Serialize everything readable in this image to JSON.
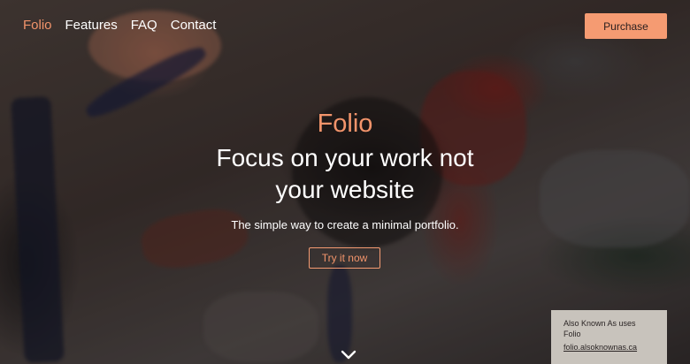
{
  "nav": {
    "items": [
      {
        "label": "Folio",
        "active": true
      },
      {
        "label": "Features",
        "active": false
      },
      {
        "label": "FAQ",
        "active": false
      },
      {
        "label": "Contact",
        "active": false
      }
    ],
    "purchase_label": "Purchase"
  },
  "hero": {
    "brand": "Folio",
    "headline_line1": "Focus on your work not",
    "headline_line2": "your website",
    "tagline": "The simple way to create a minimal portfolio.",
    "cta_label": "Try it now",
    "scroll_icon": "chevron-down-icon"
  },
  "credit": {
    "text": "Also Known As uses Folio",
    "link": "folio.alsoknownas.ca"
  },
  "colors": {
    "accent": "#f59b72",
    "accent_text": "#f2946b",
    "credit_bg": "#c8c3bc"
  }
}
